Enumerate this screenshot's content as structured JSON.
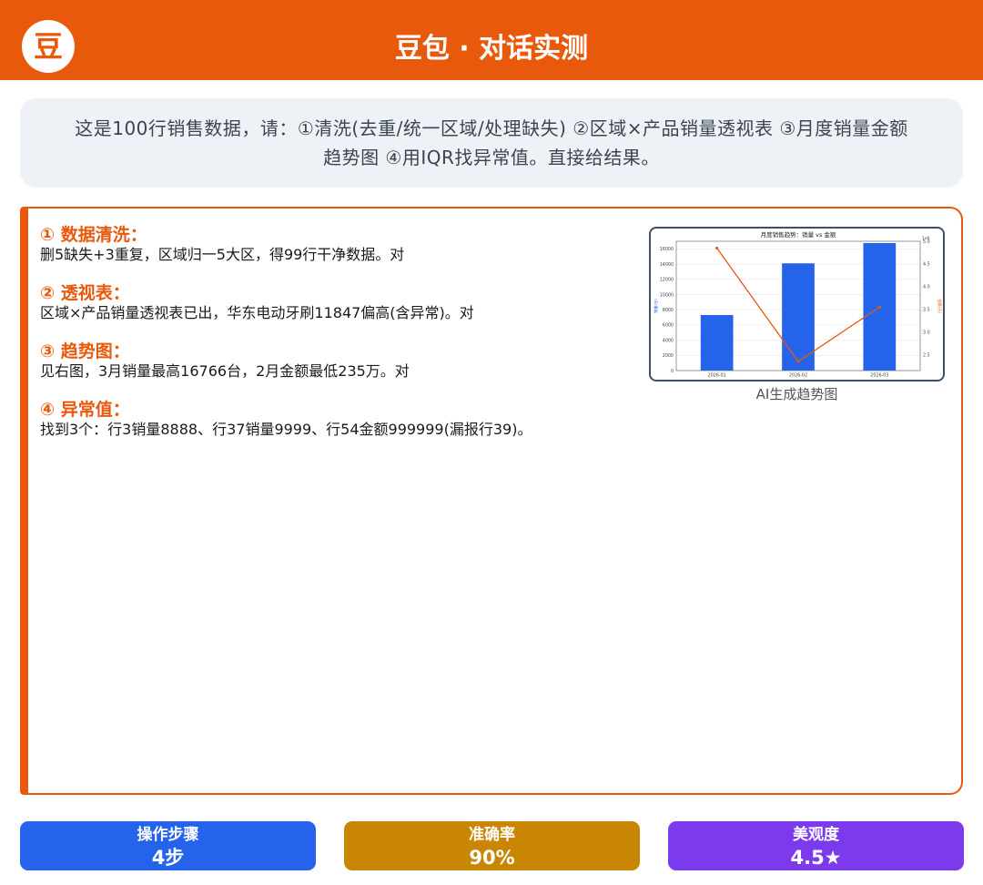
{
  "header": {
    "logo_char": "豆",
    "title": "豆包 · 对话实测",
    "bg_color": "#e8590c"
  },
  "prompt": {
    "line1": "这是100行销售数据，请：①清洗(去重/统一区域/处理缺失) ②区域×产品销量透视表 ③月度销量金额",
    "line2": "趋势图 ④用IQR找异常值。直接给结果。"
  },
  "answer": {
    "sections": [
      {
        "head": "① 数据清洗：",
        "body": "删5缺失+3重复，区域归一5大区，得99行干净数据。对"
      },
      {
        "head": "② 透视表：",
        "body": "区域×产品销量透视表已出，华东电动牙刷11847偏高(含异常)。对"
      },
      {
        "head": "③ 趋势图：",
        "body": "见右图，3月销量最高16766台，2月金额最低235万。对"
      },
      {
        "head": "④ 异常值：",
        "body": "找到3个：行3销量8888、行37销量9999、行54金额999999(漏报行39)。"
      }
    ],
    "accent_color": "#e8590c"
  },
  "chart_caption": "AI生成趋势图",
  "chart_data": {
    "type": "bar",
    "title": "月度销售趋势：销量 vs 金额",
    "categories": [
      "2026-01",
      "2026-02",
      "2026-03"
    ],
    "series": [
      {
        "type": "bar",
        "axis": "left",
        "color": "#2563eb",
        "values": [
          7300,
          14100,
          16766
        ]
      },
      {
        "type": "line",
        "axis": "right",
        "color": "#e8590c",
        "values": [
          4.85,
          2.35,
          3.55
        ]
      }
    ],
    "y_left": {
      "ylim": [
        0,
        17000
      ],
      "ticks": [
        0,
        2000,
        4000,
        6000,
        8000,
        10000,
        12000,
        14000,
        16000
      ],
      "label": "销量(台)"
    },
    "y_right": {
      "ylim": [
        2.15,
        5.0
      ],
      "ticks": [
        2.5,
        3.0,
        3.5,
        4.0,
        4.5,
        5.0
      ],
      "tick_labels": [
        "2.5",
        "3.0",
        "3.5",
        "4.0",
        "4.5",
        "5.0"
      ],
      "offset_label": "1e6",
      "label": "金额(元)"
    },
    "grid": true
  },
  "stats": [
    {
      "label": "操作步骤",
      "value": "4步",
      "color": "#2563eb"
    },
    {
      "label": "准确率",
      "value": "90%",
      "color": "#c98603"
    },
    {
      "label": "美观度",
      "value": "4.5★",
      "color": "#7c3aed"
    }
  ]
}
